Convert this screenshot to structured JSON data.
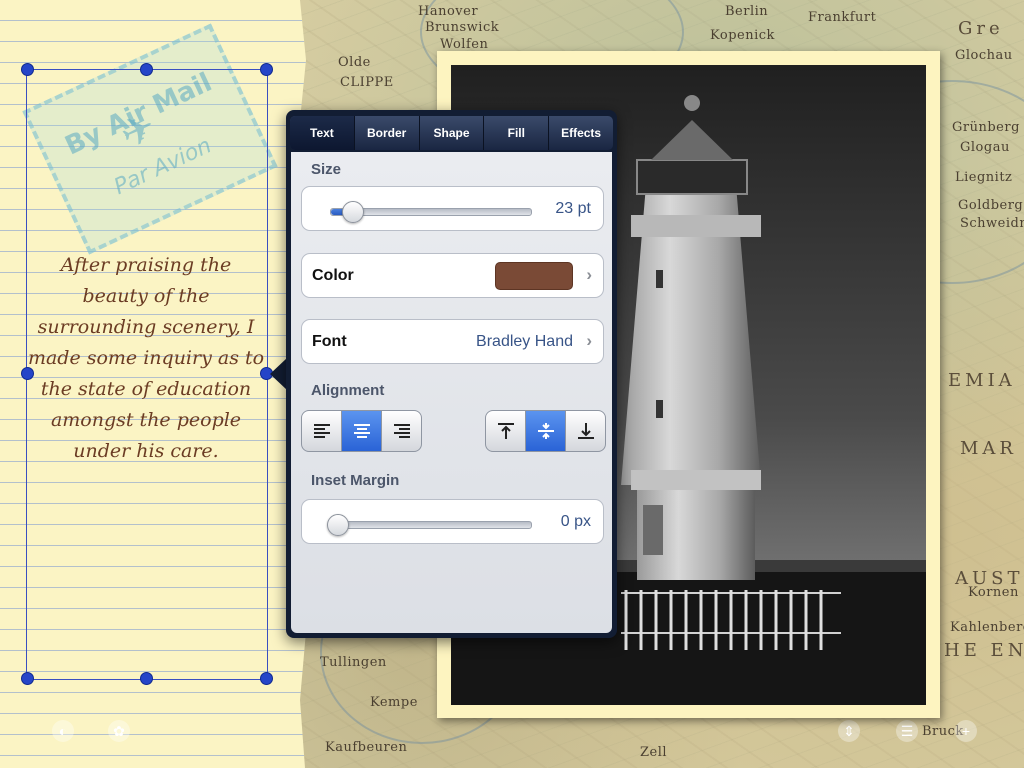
{
  "map": {
    "labels": [
      "Hanover",
      "Brunswick",
      "Wolfen",
      "Olde",
      "CLIPPE",
      "Berlin",
      "Frankfurt",
      "Kopenick",
      "Gre",
      "Glochau",
      "Grünberg",
      "Glogau",
      "Liegnitz",
      "Goldberg",
      "Schweidn",
      "EMIA",
      "MAR",
      "AUSTR",
      "Kornen",
      "Kahlenberg",
      "HE ENNS",
      "Tullingen",
      "Kempe",
      "Kaufbeuren",
      "Zell",
      "Bruck"
    ]
  },
  "note": {
    "text": "After praising the beauty of the surrounding scenery, I made some inquiry as to the state of education amongst the people under his care."
  },
  "stamp": {
    "line1": "By Air Mail",
    "line2": "Par Avion"
  },
  "popover": {
    "tabs": [
      {
        "label": "Text",
        "active": true
      },
      {
        "label": "Border",
        "active": false
      },
      {
        "label": "Shape",
        "active": false
      },
      {
        "label": "Fill",
        "active": false
      },
      {
        "label": "Effects",
        "active": false
      }
    ],
    "size": {
      "title": "Size",
      "value": "23 pt",
      "level": 0.06
    },
    "color": {
      "label": "Color",
      "swatch": "#7a4a36"
    },
    "font": {
      "label": "Font",
      "value": "Bradley Hand"
    },
    "alignment": {
      "title": "Alignment",
      "horizontal": [
        "align-left",
        "align-center",
        "align-right"
      ],
      "horizontal_selected": "align-center",
      "vertical": [
        "align-top",
        "align-middle",
        "align-bottom"
      ],
      "vertical_selected": "align-middle"
    },
    "inset_margin": {
      "title": "Inset Margin",
      "value": "0 px",
      "level": 0.0
    }
  },
  "colors": {
    "handle": "#2545c8",
    "accent": "#2a63d6",
    "note_text": "#6b3c24"
  }
}
